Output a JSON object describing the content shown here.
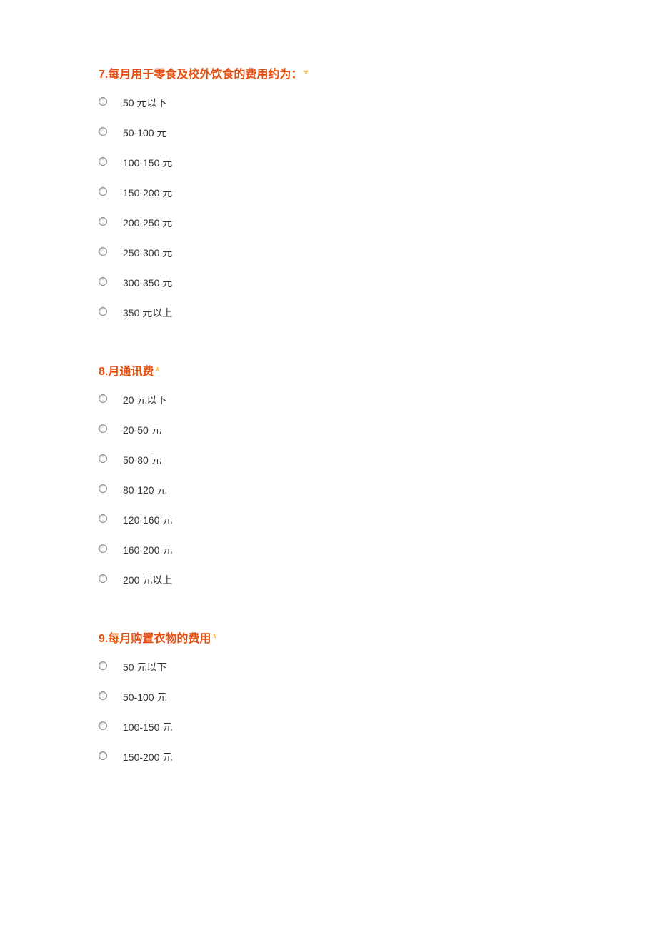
{
  "questions": [
    {
      "number": "7.",
      "title": "每月用于零食及校外饮食的费用约为：",
      "star": "*",
      "options": [
        "50 元以下",
        "50-100 元",
        "100-150 元",
        "150-200 元",
        "200-250 元",
        "250-300 元",
        "300-350 元",
        "350 元以上"
      ]
    },
    {
      "number": "8.",
      "title": "月通讯费",
      "star": "*",
      "options": [
        "20 元以下",
        "20-50 元",
        "50-80 元",
        "80-120 元",
        "120-160 元",
        "160-200 元",
        "200 元以上"
      ]
    },
    {
      "number": "9.",
      "title": "每月购置衣物的费用",
      "star": "*",
      "options": [
        "50 元以下",
        "50-100 元",
        "100-150 元",
        "150-200 元"
      ]
    }
  ]
}
